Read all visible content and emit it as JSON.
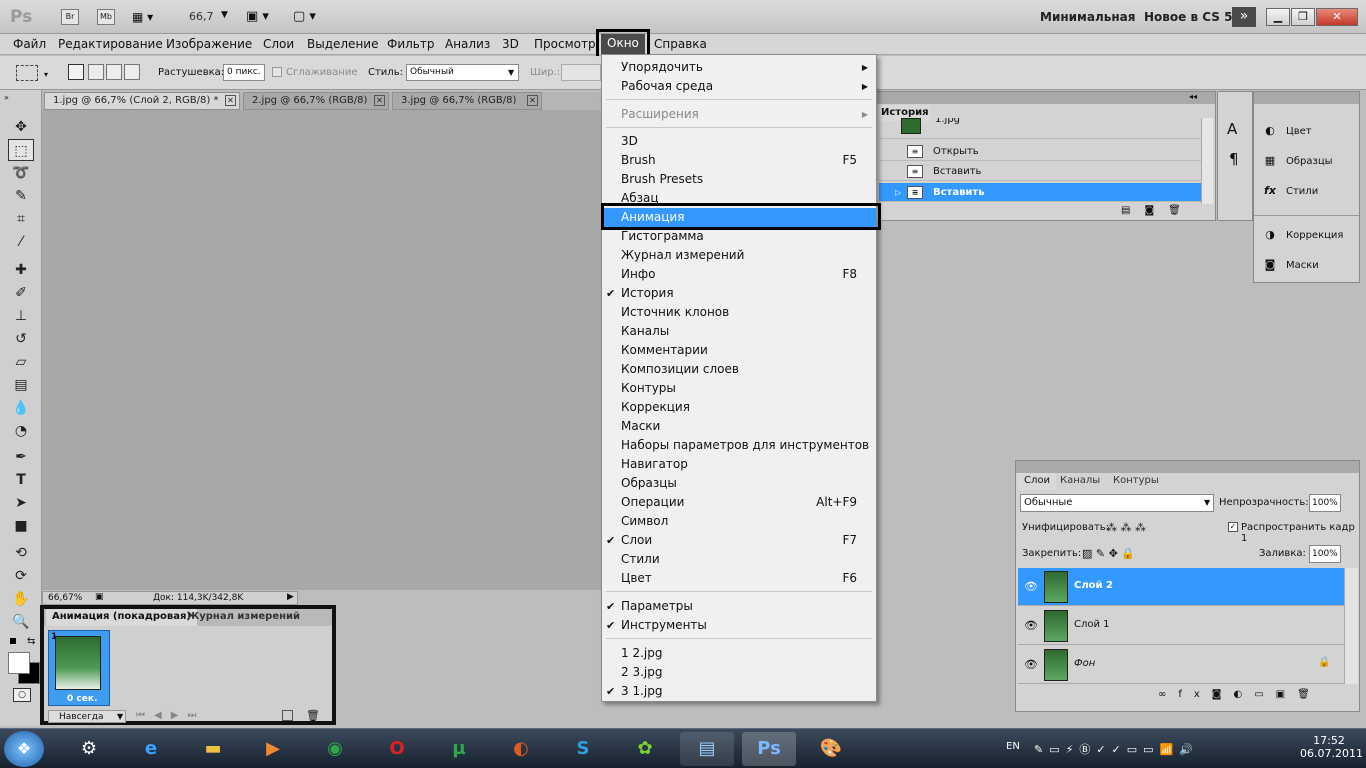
{
  "appbar": {
    "logo": "Ps",
    "bridge_btn": "Br",
    "minibridge_btn": "Mb",
    "zoom": "66,7",
    "workspaces": [
      "Минимальная",
      "Новое в CS 5"
    ],
    "more": "»"
  },
  "menubar": [
    "Файл",
    "Редактирование",
    "Изображение",
    "Слои",
    "Выделение",
    "Фильтр",
    "Анализ",
    "3D",
    "Просмотр",
    "Окно",
    "Справка"
  ],
  "options": {
    "feather_label": "Растушевка:",
    "feather_value": "0 пикс.",
    "antialias_label": "Сглаживание",
    "style_label": "Стиль:",
    "style_value": "Обычный",
    "width_label": "Шир.:"
  },
  "doc_tabs": [
    {
      "title": "1.jpg @ 66,7% (Слой 2, RGB/8) *"
    },
    {
      "title": "2.jpg @ 66,7% (RGB/8)"
    },
    {
      "title": "3.jpg @ 66,7% (RGB/8)"
    }
  ],
  "status": {
    "zoom": "66,67%",
    "doc": "Док: 114,3K/342,8K"
  },
  "animation": {
    "tabs": [
      "Анимация (покадровая)",
      "Журнал измерений"
    ],
    "frame_number": "1",
    "frame_time": "0 сек.",
    "loop": "Навсегда"
  },
  "window_menu": {
    "items": [
      {
        "label": "Упорядочить",
        "submenu": true
      },
      {
        "label": "Рабочая среда",
        "submenu": true
      },
      {
        "label": "Расширения",
        "submenu": true,
        "disabled": true
      },
      {
        "label": "3D"
      },
      {
        "label": "Brush",
        "shortcut": "F5"
      },
      {
        "label": "Brush Presets"
      },
      {
        "label": "Абзац"
      },
      {
        "label": "Анимация",
        "highlighted": true
      },
      {
        "label": "Гистограмма"
      },
      {
        "label": "Журнал измерений"
      },
      {
        "label": "Инфо",
        "shortcut": "F8"
      },
      {
        "label": "История",
        "checked": true
      },
      {
        "label": "Источник клонов"
      },
      {
        "label": "Каналы"
      },
      {
        "label": "Комментарии"
      },
      {
        "label": "Композиции слоев"
      },
      {
        "label": "Контуры"
      },
      {
        "label": "Коррекция"
      },
      {
        "label": "Маски"
      },
      {
        "label": "Наборы параметров для инструментов"
      },
      {
        "label": "Навигатор"
      },
      {
        "label": "Образцы"
      },
      {
        "label": "Операции",
        "shortcut": "Alt+F9"
      },
      {
        "label": "Символ"
      },
      {
        "label": "Слои",
        "shortcut": "F7",
        "checked": true
      },
      {
        "label": "Стили"
      },
      {
        "label": "Цвет",
        "shortcut": "F6"
      },
      {
        "label": "Параметры",
        "checked": true
      },
      {
        "label": "Инструменты",
        "checked": true
      },
      {
        "label": "1 2.jpg"
      },
      {
        "label": "2 3.jpg"
      },
      {
        "label": "3 1.jpg",
        "checked": true
      }
    ]
  },
  "history": {
    "tab": "История",
    "rows": [
      {
        "label": "1.jpg"
      },
      {
        "label": "Открыть"
      },
      {
        "label": "Вставить"
      },
      {
        "label": "Вставить",
        "selected": true
      }
    ]
  },
  "dock": {
    "group1": [
      "Цвет",
      "Образцы",
      "Стили"
    ],
    "group2": [
      "Коррекция",
      "Маски"
    ]
  },
  "layers": {
    "tabs": [
      "Слои",
      "Каналы",
      "Контуры"
    ],
    "blend": "Обычные",
    "opacity_label": "Непрозрачность:",
    "opacity": "100%",
    "unify_label": "Унифицировать:",
    "propagate_label": "Распространить кадр 1",
    "lock_label": "Закрепить:",
    "fill_label": "Заливка:",
    "fill": "100%",
    "rows": [
      {
        "name": "Слой 2",
        "selected": true
      },
      {
        "name": "Слой 1"
      },
      {
        "name": "Фон",
        "locked": true
      }
    ]
  },
  "taskbar": {
    "lang": "EN",
    "time": "17:52",
    "date": "06.07.2011"
  }
}
